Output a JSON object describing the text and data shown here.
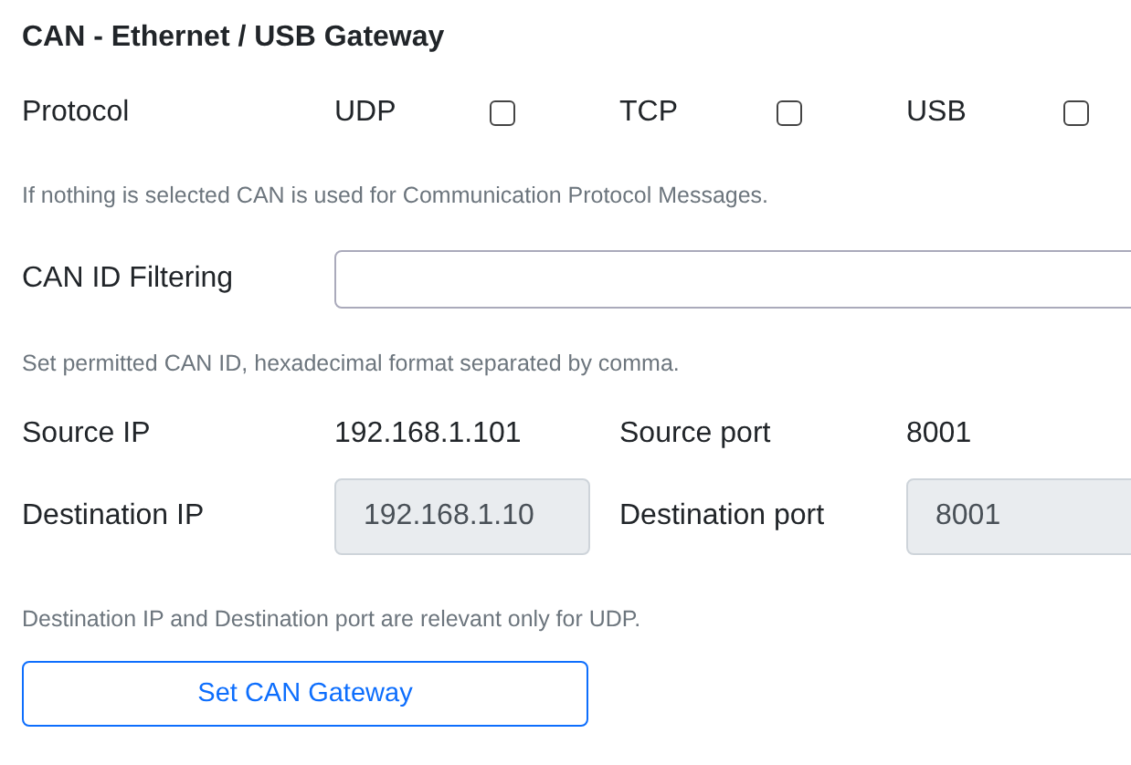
{
  "title": "CAN - Ethernet / USB Gateway",
  "protocol": {
    "label": "Protocol",
    "options": [
      {
        "label": "UDP",
        "checked": false
      },
      {
        "label": "TCP",
        "checked": false
      },
      {
        "label": "USB",
        "checked": false
      }
    ]
  },
  "protocol_hint": "If nothing is selected CAN is used for Communication Protocol Messages.",
  "can_id_filter": {
    "label": "CAN ID Filtering"
  },
  "can_id_hint": "Set permitted CAN ID, hexadecimal format separated by comma.",
  "source": {
    "ip_label": "Source IP",
    "ip": "192.168.1.101",
    "port_label": "Source port",
    "port": "8001"
  },
  "destination": {
    "ip_label": "Destination IP",
    "ip": "192.168.1.10",
    "port_label": "Destination port",
    "port": "8001",
    "disabled": true
  },
  "destination_hint": "Destination IP and Destination port are relevant only for UDP.",
  "button": "Set CAN Gateway"
}
